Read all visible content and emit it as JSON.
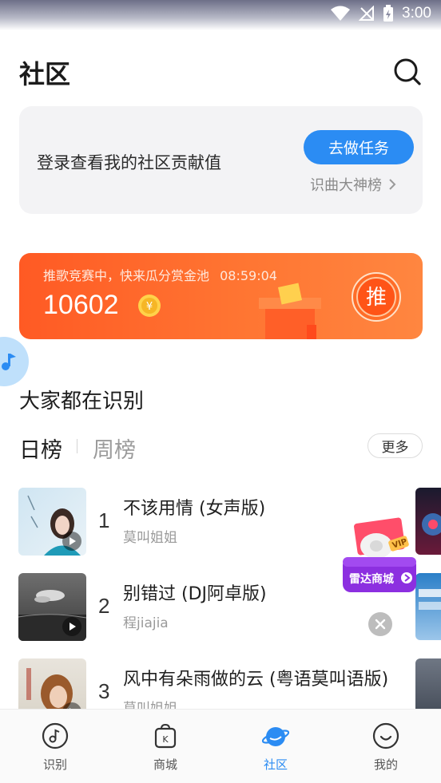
{
  "status_bar": {
    "time": "3:00",
    "icons": [
      "wifi-icon",
      "no-signal-icon",
      "battery-charging-icon"
    ]
  },
  "header": {
    "title": "社区",
    "search_icon": "search-icon"
  },
  "contribution_card": {
    "text": "登录查看我的社区贡献值",
    "task_button": "去做任务",
    "ranking_link": "识曲大神榜"
  },
  "contest_banner": {
    "text": "推歌竞赛中，快来瓜分赏金池",
    "countdown": "08:59:04",
    "amount": "10602",
    "badge": "推"
  },
  "section": {
    "title": "大家都在识别",
    "tab_daily": "日榜",
    "tab_weekly": "周榜",
    "more": "更多"
  },
  "songs": [
    {
      "rank": "1",
      "title": "不该用情 (女声版)",
      "artist": "莫叫姐姐"
    },
    {
      "rank": "2",
      "title": "别错过 (DJ阿卓版)",
      "artist": "程jiajia"
    },
    {
      "rank": "3",
      "title": "风中有朵雨做的云 (粤语莫叫语版)",
      "artist": "莫叫姐姐"
    }
  ],
  "promo": {
    "label": "雷达商城",
    "tag": "VIP"
  },
  "bottom_nav": [
    {
      "label": "识别",
      "icon": "music-note-icon",
      "active": false
    },
    {
      "label": "商城",
      "icon": "shop-bag-icon",
      "active": false
    },
    {
      "label": "社区",
      "icon": "planet-icon",
      "active": true
    },
    {
      "label": "我的",
      "icon": "smile-face-icon",
      "active": false
    }
  ],
  "colors": {
    "accent": "#2b8cf3",
    "banner": "#ff6a2c",
    "card_bg": "#f3f3f5"
  }
}
